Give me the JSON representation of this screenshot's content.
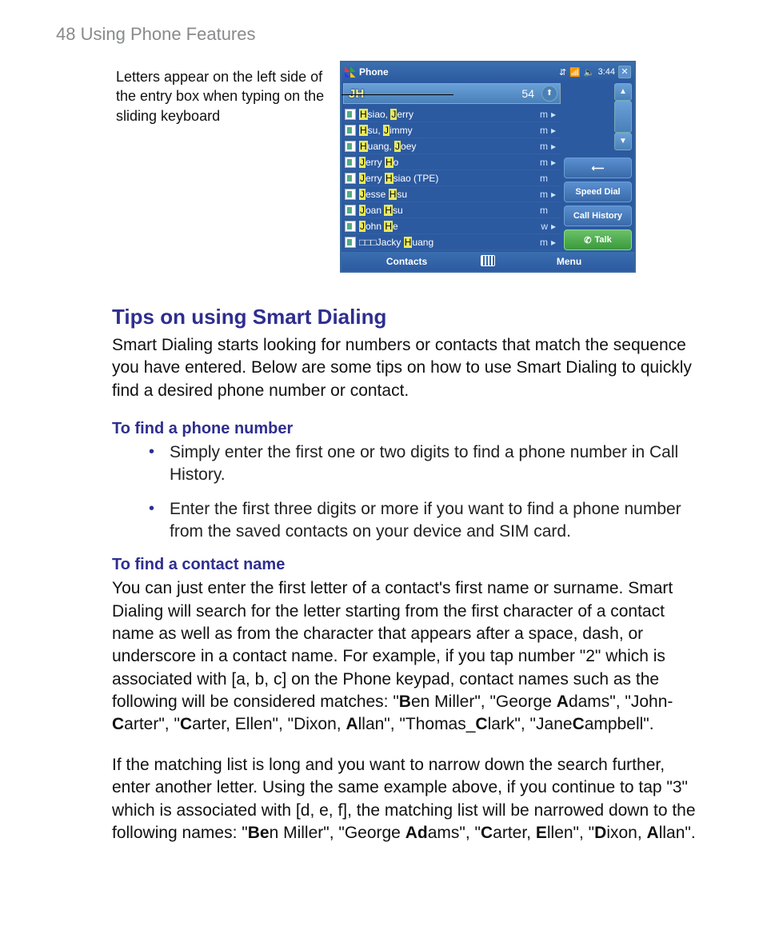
{
  "page_header": "48  Using Phone Features",
  "caption": "Letters appear on the left side of the entry box when typing on the sliding keyboard",
  "phone": {
    "title": "Phone",
    "time": "3:44",
    "entry": "JH",
    "count": "54",
    "contacts": [
      {
        "pre": "H",
        "mid": "siao, ",
        "pre2": "J",
        "post": "erry",
        "t": "m",
        "ar": "▸"
      },
      {
        "pre": "H",
        "mid": "su, ",
        "pre2": "J",
        "post": "immy",
        "t": "m",
        "ar": "▸"
      },
      {
        "pre": "H",
        "mid": "uang, ",
        "pre2": "J",
        "post": "oey",
        "t": "m",
        "ar": "▸"
      },
      {
        "pre": "J",
        "mid": "erry ",
        "pre2": "H",
        "post": "o",
        "t": "m",
        "ar": "▸"
      },
      {
        "pre": "J",
        "mid": "erry ",
        "pre2": "H",
        "post": "siao (TPE)",
        "t": "m",
        "ar": ""
      },
      {
        "pre": "J",
        "mid": "esse ",
        "pre2": "H",
        "post": "su",
        "t": "m",
        "ar": "▸"
      },
      {
        "pre": "J",
        "mid": "oan ",
        "pre2": "H",
        "post": "su",
        "t": "m",
        "ar": ""
      },
      {
        "pre": "J",
        "mid": "ohn ",
        "pre2": "H",
        "post": "e",
        "t": "w",
        "ar": "▸"
      },
      {
        "pre": "",
        "mid": "□□□Jacky ",
        "pre2": "H",
        "post": "uang",
        "t": "m",
        "ar": "▸"
      }
    ],
    "back_label": "",
    "speed_dial": "Speed Dial",
    "call_history": "Call History",
    "talk": "Talk",
    "soft_left": "Contacts",
    "soft_right": "Menu"
  },
  "h2": "Tips on using Smart Dialing",
  "p1": "Smart Dialing starts looking for numbers or contacts that match the sequence you have entered. Below are some tips on how to use Smart Dialing to quickly find a desired phone number or contact.",
  "h3a": "To find a phone number",
  "b1": "Simply enter the first one or two digits to find a phone number in Call History.",
  "b2": "Enter the first three digits or more if you want to find a phone number from the saved contacts on your device and SIM card.",
  "h3b": "To find a contact name",
  "p2_parts": [
    "You can just enter the first letter of a contact's first name or surname. Smart Dialing will search for the letter starting from the first character of a contact name as well as from the character that appears after a space, dash, or underscore in a contact name. For example, if you tap number \"2\" which is associated with [a, b, c] on the Phone keypad, contact names such as the following will be considered matches: \"",
    "B",
    "en Miller\", \"George ",
    "A",
    "dams\", \"John-",
    "C",
    "arter\", \"",
    "C",
    "arter, Ellen\", \"Dixon, ",
    "A",
    "llan\", \"Thomas_",
    "C",
    "lark\", \"Jane",
    "C",
    "ampbell\"."
  ],
  "p3_parts": [
    "If the matching list is long and you want to narrow down the search further, enter another letter. Using the same example above, if you continue to tap \"3\" which is associated with [d, e, f], the matching list will be narrowed down to the following names: \"",
    "Be",
    "n Miller\", \"George ",
    "Ad",
    "ams\", \"",
    "C",
    "arter, ",
    "E",
    "llen\", \"",
    "D",
    "ixon, ",
    "A",
    "llan\"."
  ]
}
